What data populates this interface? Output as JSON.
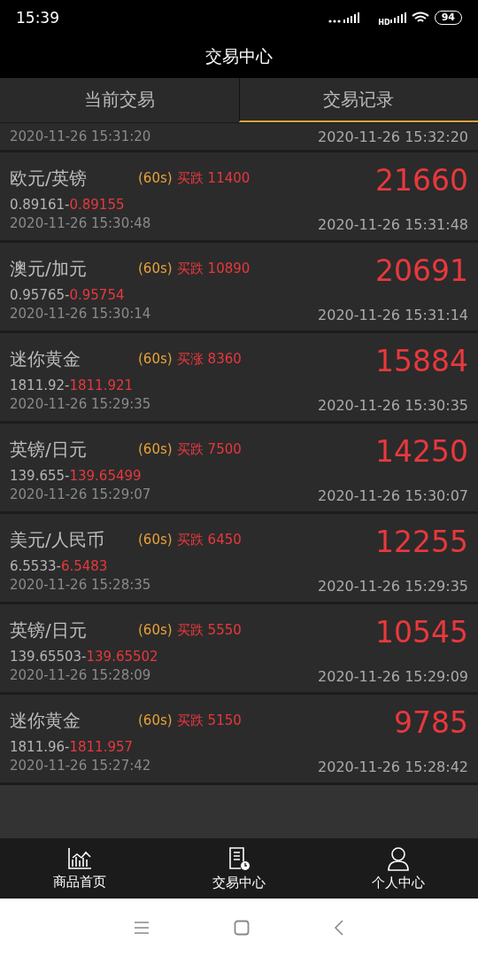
{
  "status_bar": {
    "time": "15:39",
    "network": "HD",
    "battery": "94"
  },
  "header": {
    "title": "交易中心"
  },
  "tabs": [
    {
      "label": "当前交易",
      "selected": false
    },
    {
      "label": "交易记录",
      "selected": true
    }
  ],
  "partial_row": {
    "open_time": "2020-11-26 15:31:20",
    "close_time": "2020-11-26 15:32:20"
  },
  "trades": [
    {
      "name": "欧元/英镑",
      "duration": "(60s)",
      "direction": "买跌",
      "amount": "11400",
      "open_price": "0.89161-",
      "close_price": "0.89155",
      "open_time": "2020-11-26 15:30:48",
      "result": "21660",
      "close_time": "2020-11-26 15:31:48"
    },
    {
      "name": "澳元/加元",
      "duration": "(60s)",
      "direction": "买跌",
      "amount": "10890",
      "open_price": "0.95765-",
      "close_price": "0.95754",
      "open_time": "2020-11-26 15:30:14",
      "result": "20691",
      "close_time": "2020-11-26 15:31:14"
    },
    {
      "name": "迷你黄金",
      "duration": "(60s)",
      "direction": "买涨",
      "amount": "8360",
      "open_price": "1811.92-",
      "close_price": "1811.921",
      "open_time": "2020-11-26 15:29:35",
      "result": "15884",
      "close_time": "2020-11-26 15:30:35"
    },
    {
      "name": "英镑/日元",
      "duration": "(60s)",
      "direction": "买跌",
      "amount": "7500",
      "open_price": "139.655-",
      "close_price": "139.65499",
      "open_time": "2020-11-26 15:29:07",
      "result": "14250",
      "close_time": "2020-11-26 15:30:07"
    },
    {
      "name": "美元/人民币",
      "duration": "(60s)",
      "direction": "买跌",
      "amount": "6450",
      "open_price": "6.5533-",
      "close_price": "6.5483",
      "open_time": "2020-11-26 15:28:35",
      "result": "12255",
      "close_time": "2020-11-26 15:29:35"
    },
    {
      "name": "英镑/日元",
      "duration": "(60s)",
      "direction": "买跌",
      "amount": "5550",
      "open_price": "139.65503-",
      "close_price": "139.65502",
      "open_time": "2020-11-26 15:28:09",
      "result": "10545",
      "close_time": "2020-11-26 15:29:09"
    },
    {
      "name": "迷你黄金",
      "duration": "(60s)",
      "direction": "买跌",
      "amount": "5150",
      "open_price": "1811.96-",
      "close_price": "1811.957",
      "open_time": "2020-11-26 15:27:42",
      "result": "9785",
      "close_time": "2020-11-26 15:28:42"
    }
  ],
  "bottom_nav": [
    {
      "label": "商品首页",
      "kind": "chart"
    },
    {
      "label": "交易中心",
      "kind": "record"
    },
    {
      "label": "个人中心",
      "kind": "person"
    }
  ]
}
